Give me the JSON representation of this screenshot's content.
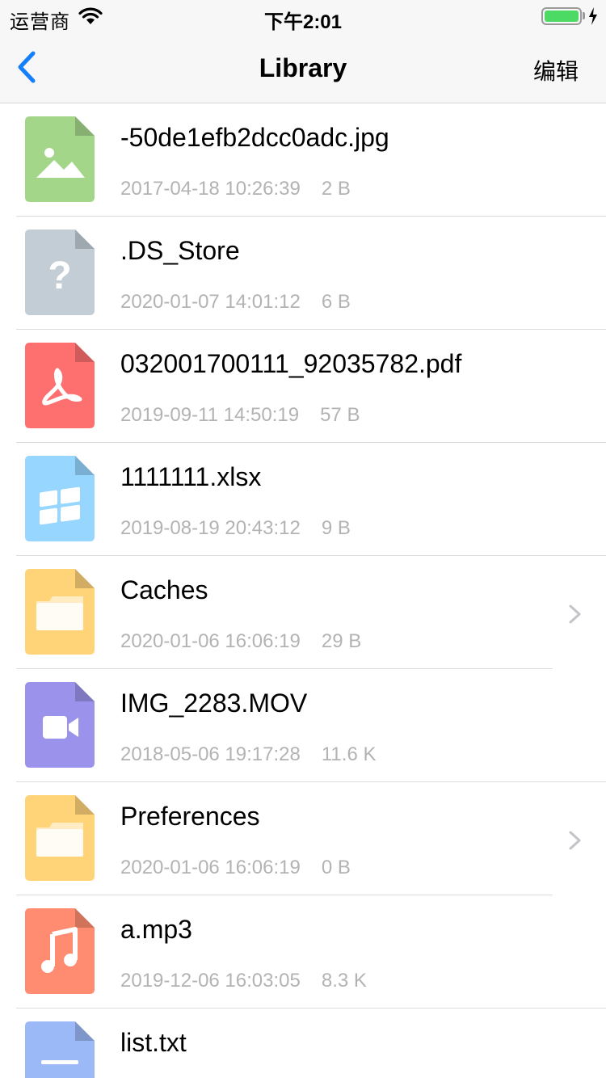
{
  "status_bar": {
    "carrier": "运营商",
    "time": "下午2:01",
    "battery_color": "#4cd964"
  },
  "nav": {
    "title": "Library",
    "edit_label": "编辑",
    "back_icon": "chevron-left-icon",
    "accent": "#147efb"
  },
  "files": [
    {
      "name": "-50de1efb2dcc0adc.jpg",
      "date": "2017-04-18 10:26:39",
      "size": "2 B",
      "type": "image",
      "color": "#a4d68a"
    },
    {
      "name": ".DS_Store",
      "date": "2020-01-07 14:01:12",
      "size": "6 B",
      "type": "unknown",
      "color": "#c3cdd6"
    },
    {
      "name": "032001700111_92035782.pdf",
      "date": "2019-09-11 14:50:19",
      "size": "57 B",
      "type": "pdf",
      "color": "#fe6f6f"
    },
    {
      "name": "1111111.xlsx",
      "date": "2019-08-19 20:43:12",
      "size": "9 B",
      "type": "windows",
      "color": "#97d6ff"
    },
    {
      "name": "Caches",
      "date": "2020-01-06 16:06:19",
      "size": "29 B",
      "type": "folder",
      "color": "#ffd479"
    },
    {
      "name": "IMG_2283.MOV",
      "date": "2018-05-06 19:17:28",
      "size": "11.6 K",
      "type": "video",
      "color": "#9b92eb"
    },
    {
      "name": "Preferences",
      "date": "2020-01-06 16:06:19",
      "size": "0 B",
      "type": "folder",
      "color": "#ffd479"
    },
    {
      "name": "a.mp3",
      "date": "2019-12-06 16:03:05",
      "size": "8.3 K",
      "type": "audio",
      "color": "#ff8b70"
    },
    {
      "name": "list.txt",
      "date": "",
      "size": "",
      "type": "text",
      "color": "#9bb8f7"
    }
  ]
}
